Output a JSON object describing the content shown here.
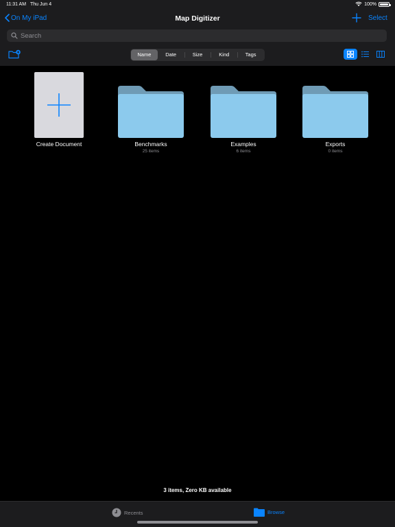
{
  "status": {
    "time": "11:31 AM",
    "date": "Thu Jun 4",
    "battery_text": "100%",
    "battery_level": 1.0
  },
  "nav": {
    "back_label": "On My iPad",
    "title": "Map Digitizer",
    "select_label": "Select"
  },
  "search": {
    "placeholder": "Search",
    "value": ""
  },
  "sort": {
    "options": [
      "Name",
      "Date",
      "Size",
      "Kind",
      "Tags"
    ],
    "selected": "Name"
  },
  "view_modes": [
    "grid-view-icon",
    "list-view-icon",
    "column-view-icon"
  ],
  "items": [
    {
      "type": "create",
      "name": "Create Document",
      "count": ""
    },
    {
      "type": "folder",
      "name": "Benchmarks",
      "count": "25 items"
    },
    {
      "type": "folder",
      "name": "Examples",
      "count": "6 items"
    },
    {
      "type": "folder",
      "name": "Exports",
      "count": "0 items"
    }
  ],
  "summary": "3 items, Zero KB available",
  "tabs": [
    {
      "label": "Recents",
      "icon": "clock-icon",
      "active": false
    },
    {
      "label": "Browse",
      "icon": "folder-icon",
      "active": true
    }
  ],
  "colors": {
    "accent": "#0a84ff",
    "background": "#000000",
    "chrome": "#1c1c1e",
    "folder_top": "#6f9bb5",
    "folder_body": "#8ccaed"
  }
}
